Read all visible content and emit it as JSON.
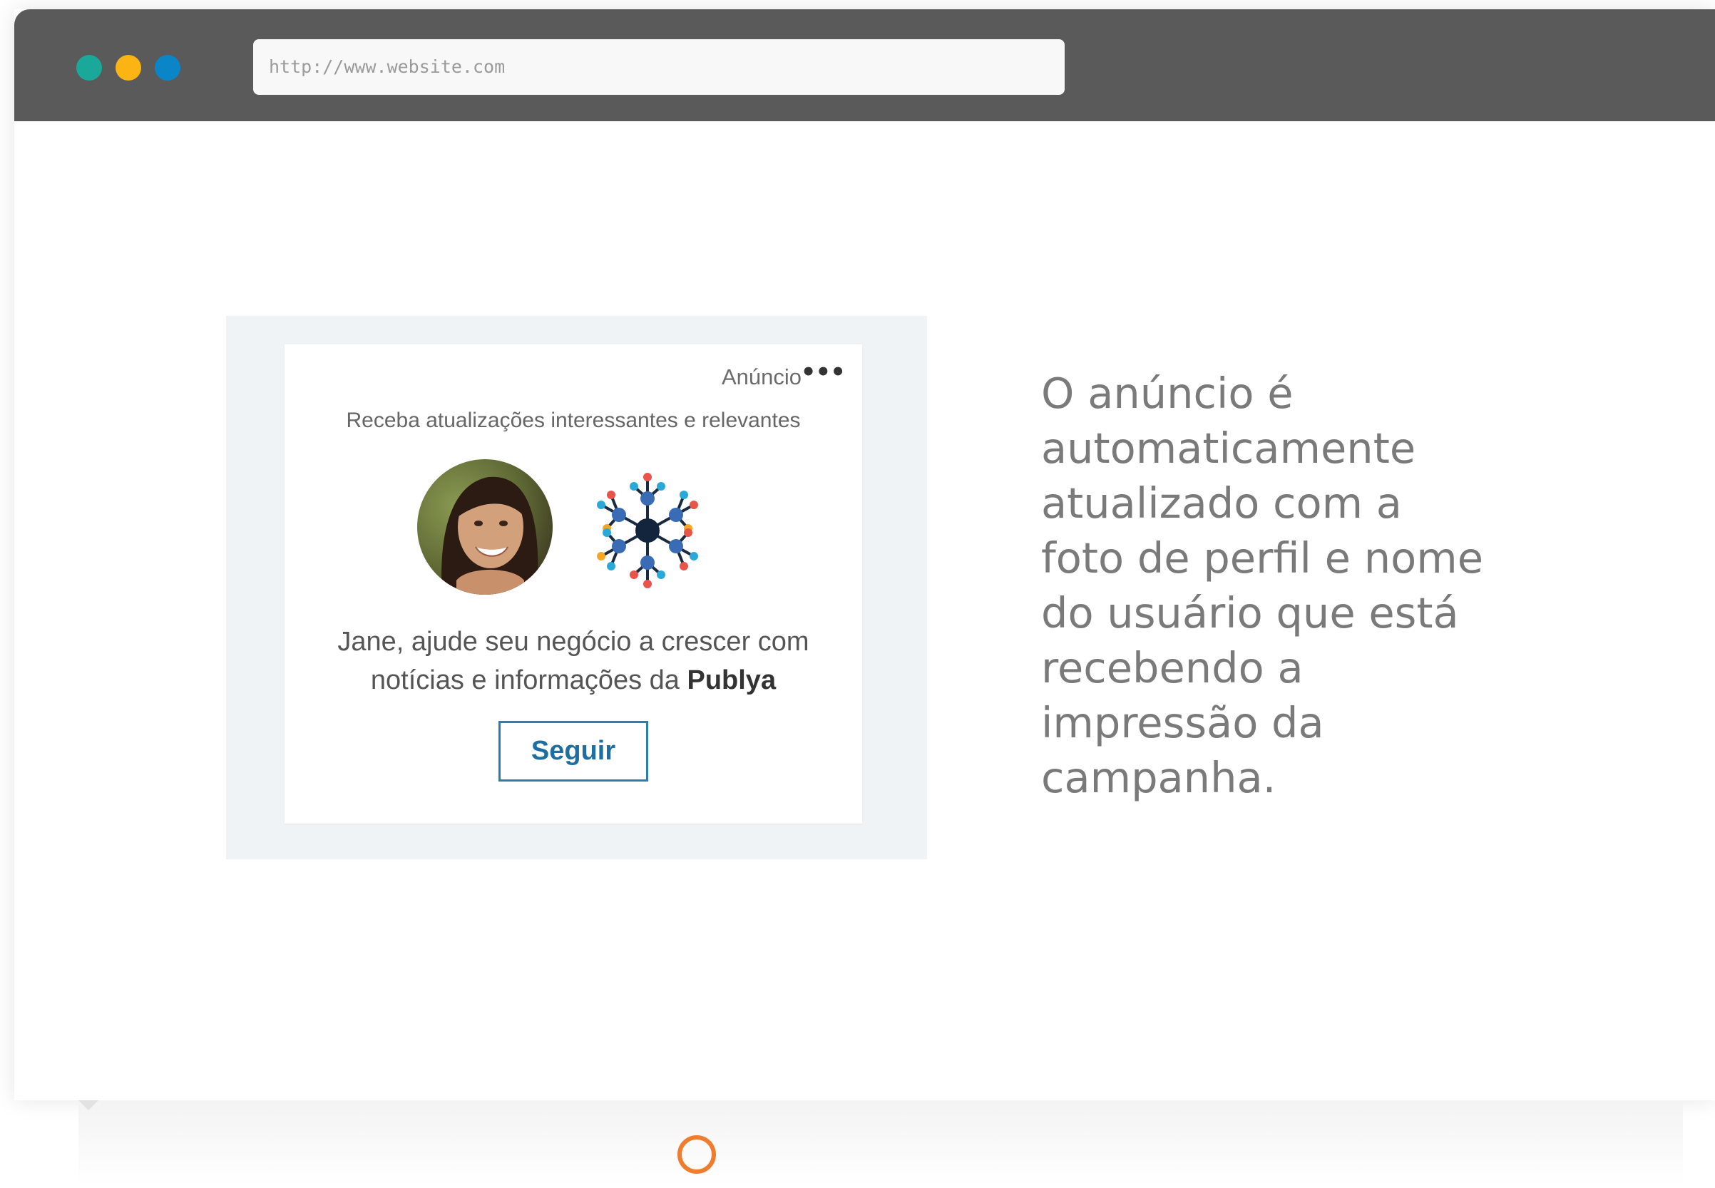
{
  "browser": {
    "url": "http://www.website.com",
    "dots": [
      {
        "name": "window-dot-teal",
        "color": "#1aa89a"
      },
      {
        "name": "window-dot-yellow",
        "color": "#fbb414"
      },
      {
        "name": "window-dot-blue",
        "color": "#0a86c8"
      }
    ]
  },
  "ad": {
    "label": "Anúncio",
    "more_icon": "•••",
    "headline": "Receba atualizações interessantes e relevantes",
    "body_prefix": "Jane, ajude seu negócio a crescer com notícias e informações da",
    "company": "Publya",
    "follow_label": "Seguir",
    "avatar_icon": "profile-photo",
    "logo_icon": "network-snowflake-logo"
  },
  "description": "O anúncio é automaticamente atualizado com a foto de perfil e nome do usuário que está recebendo a impressão da campanha.",
  "colors": {
    "titlebar": "#5a5a5a",
    "accent_blue": "#2a7fb0",
    "ring_orange": "#ef7d2d"
  }
}
